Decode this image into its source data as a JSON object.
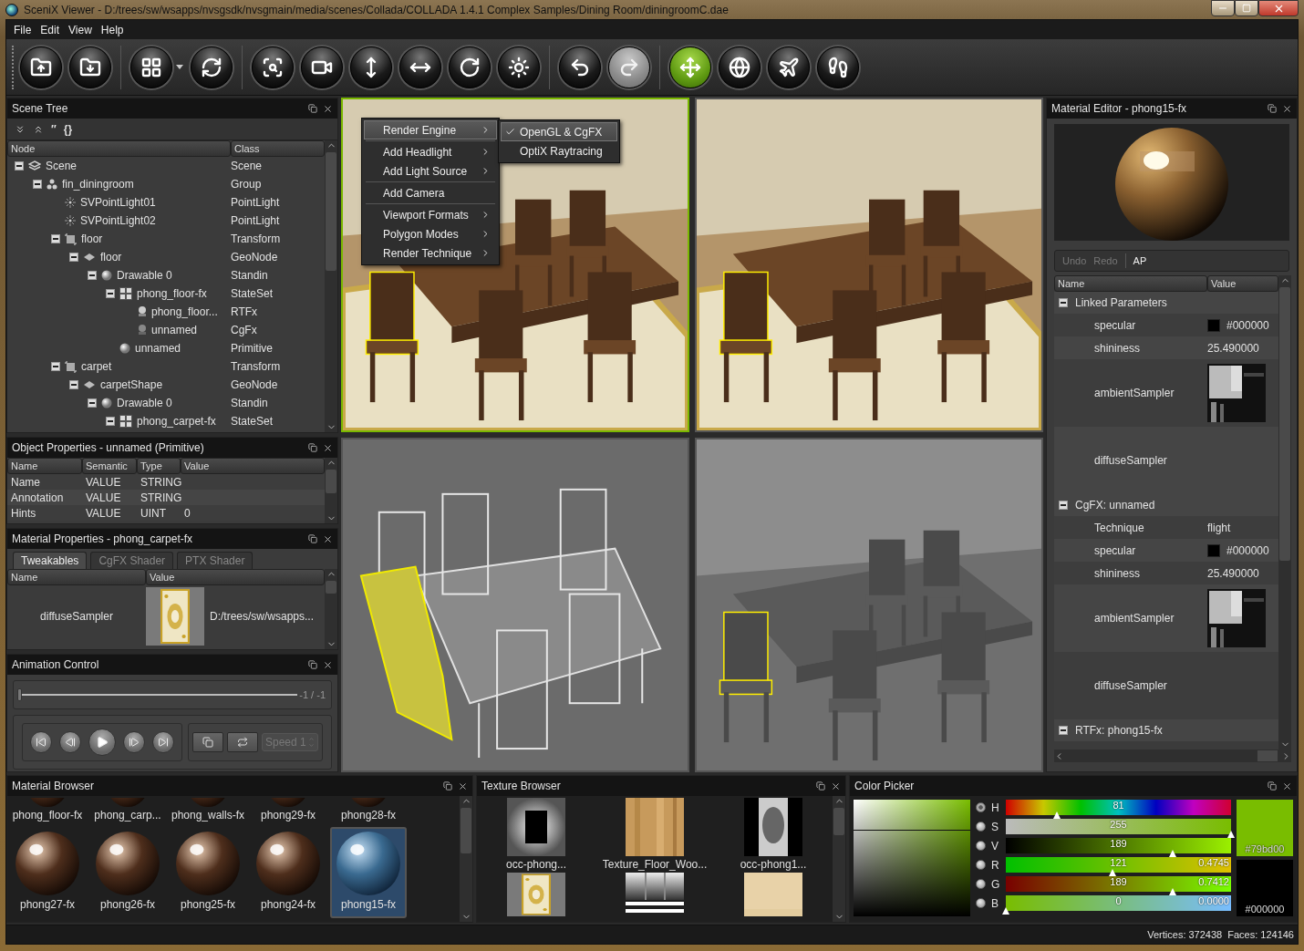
{
  "window": {
    "title": "SceniX Viewer - D:/trees/sw/wsapps/nvsgsdk/nvsgmain/media/scenes/Collada/COLLADA 1.4.1 Complex Samples/Dining Room/diningroomC.dae"
  },
  "menu": [
    "File",
    "Edit",
    "View",
    "Help"
  ],
  "toolbar": [
    [
      {
        "kind": "open",
        "selected": false,
        "disabled": false
      },
      {
        "kind": "save",
        "selected": false,
        "disabled": false
      }
    ],
    [
      {
        "kind": "layout",
        "selected": false,
        "disabled": false
      },
      {
        "kind": "refresh",
        "selected": false,
        "disabled": false
      }
    ],
    [
      {
        "kind": "zoom",
        "selected": false,
        "disabled": false
      },
      {
        "kind": "camera",
        "selected": false,
        "disabled": false
      },
      {
        "kind": "vertical",
        "selected": false,
        "disabled": false
      },
      {
        "kind": "horizontal",
        "selected": false,
        "disabled": false
      },
      {
        "kind": "rotate",
        "selected": false,
        "disabled": false
      },
      {
        "kind": "light",
        "selected": false,
        "disabled": false
      }
    ],
    [
      {
        "kind": "undo",
        "selected": false,
        "disabled": false
      },
      {
        "kind": "redo",
        "selected": false,
        "disabled": true
      }
    ],
    [
      {
        "kind": "navigate",
        "selected": true,
        "disabled": false
      },
      {
        "kind": "orbit",
        "selected": false,
        "disabled": false
      },
      {
        "kind": "fly",
        "selected": false,
        "disabled": false
      },
      {
        "kind": "walk",
        "selected": false,
        "disabled": false
      }
    ]
  ],
  "scene_tree": {
    "title": "Scene Tree",
    "tools": [
      {
        "kind": "expand"
      },
      {
        "kind": "collapse"
      },
      {
        "kind": "text",
        "label": "″"
      },
      {
        "kind": "text",
        "label": "{}"
      }
    ],
    "columns": [
      "Node",
      "Class"
    ],
    "nodes": [
      {
        "name": "Scene",
        "class": "Scene",
        "kind": "scene",
        "expanded": true,
        "children": [
          {
            "name": "fin_diningroom",
            "class": "Group",
            "kind": "group",
            "expanded": true,
            "children": [
              {
                "name": "SVPointLight01",
                "class": "PointLight",
                "kind": "light",
                "expanded": false
              },
              {
                "name": "SVPointLight02",
                "class": "PointLight",
                "kind": "light",
                "expanded": false
              },
              {
                "name": "floor",
                "class": "Transform",
                "kind": "transform",
                "expanded": true,
                "children": [
                  {
                    "name": "floor",
                    "class": "GeoNode",
                    "kind": "geonode",
                    "expanded": true,
                    "children": [
                      {
                        "name": "Drawable 0",
                        "class": "Standin",
                        "kind": "drawable",
                        "expanded": true,
                        "children": [
                          {
                            "name": "phong_floor-fx",
                            "class": "StateSet",
                            "kind": "stateset",
                            "expanded": true,
                            "children": [
                              {
                                "name": "phong_floor...",
                                "class": "RTFx",
                                "kind": "rtfx",
                                "expanded": false
                              },
                              {
                                "name": "unnamed",
                                "class": "CgFx",
                                "kind": "cgfx",
                                "expanded": false
                              }
                            ]
                          },
                          {
                            "name": "unnamed",
                            "class": "Primitive",
                            "kind": "drawable",
                            "expanded": false
                          }
                        ]
                      }
                    ]
                  }
                ]
              },
              {
                "name": "carpet",
                "class": "Transform",
                "kind": "transform",
                "expanded": true,
                "children": [
                  {
                    "name": "carpetShape",
                    "class": "GeoNode",
                    "kind": "geonode",
                    "expanded": true,
                    "children": [
                      {
                        "name": "Drawable 0",
                        "class": "Standin",
                        "kind": "drawable",
                        "expanded": true,
                        "children": [
                          {
                            "name": "phong_carpet-fx",
                            "class": "StateSet",
                            "kind": "stateset",
                            "expanded": true
                          }
                        ]
                      }
                    ]
                  }
                ]
              }
            ]
          }
        ]
      }
    ]
  },
  "object_properties": {
    "title": "Object Properties - unnamed (Primitive)",
    "columns": [
      "Name",
      "Semantic",
      "Type",
      "Value"
    ],
    "rows": [
      {
        "cells": [
          "Name",
          "VALUE",
          "STRING"
        ]
      },
      {
        "cells": [
          "Annotation",
          "VALUE",
          "STRING"
        ]
      },
      {
        "cells": [
          "Hints",
          "VALUE",
          "UINT",
          "0"
        ]
      }
    ]
  },
  "material_properties": {
    "title": "Material Properties - phong_carpet-fx",
    "tabs": [
      {
        "label": "Tweakables",
        "selected": true
      },
      {
        "label": "CgFX Shader",
        "selected": false
      },
      {
        "label": "PTX Shader",
        "selected": false
      }
    ],
    "columns": [
      "Name",
      "Value"
    ],
    "rows": [
      {
        "name": "diffuseSampler",
        "value": "D:/trees/sw/wsapps..."
      }
    ]
  },
  "animation": {
    "title": "Animation Control",
    "slider": {
      "level": 0,
      "reading": "-1 / -1"
    },
    "controls": [
      {
        "kind": "first"
      },
      {
        "kind": "prev"
      },
      {
        "kind": "play"
      },
      {
        "kind": "next"
      },
      {
        "kind": "last"
      }
    ],
    "tools": [
      {
        "kind": "snapshot"
      },
      {
        "kind": "loop"
      }
    ],
    "speed": {
      "value": "Speed 1",
      "disabled": true
    }
  },
  "viewports": [
    {
      "kind": "shaded",
      "selected": true
    },
    {
      "kind": "shaded",
      "selected": false
    },
    {
      "kind": "wireframe",
      "selected": false
    },
    {
      "kind": "grey",
      "selected": false
    }
  ],
  "context_menu": {
    "groups": [
      [
        {
          "label": "Render Engine",
          "submenu": true,
          "selected": true
        }
      ],
      [
        {
          "label": "Add Headlight",
          "submenu": true,
          "selected": false
        },
        {
          "label": "Add Light Source",
          "submenu": true,
          "selected": false
        }
      ],
      [
        {
          "label": "Add Camera",
          "submenu": false,
          "selected": false
        }
      ],
      [
        {
          "label": "Viewport Formats",
          "submenu": true,
          "selected": false
        },
        {
          "label": "Polygon Modes",
          "submenu": true,
          "selected": false
        },
        {
          "label": "Render Technique",
          "submenu": true,
          "selected": false
        }
      ]
    ],
    "submenu": [
      {
        "label": "OpenGL & CgFX",
        "checked": true,
        "selected": true
      },
      {
        "label": "OptiX Raytracing",
        "checked": false,
        "selected": false
      }
    ]
  },
  "material_editor": {
    "title": "Material Editor - phong15-fx",
    "tools": [
      {
        "label": "Undo",
        "disabled": true
      },
      {
        "label": "Redo",
        "disabled": true
      },
      {
        "label": "AP",
        "disabled": false
      }
    ],
    "columns": [
      "Name",
      "Value"
    ],
    "groups": [
      {
        "label": "Linked Parameters",
        "expanded": true,
        "rows": [
          {
            "kind": "color",
            "name": "specular",
            "value": "#000000",
            "color": "#000000"
          },
          {
            "kind": "text",
            "name": "shininess",
            "value": "25.490000"
          },
          {
            "kind": "texture",
            "name": "ambientSampler"
          },
          {
            "kind": "none",
            "name": "diffuseSampler"
          }
        ]
      },
      {
        "label": "CgFX: unnamed",
        "expanded": true,
        "rows": [
          {
            "kind": "text",
            "name": "Technique",
            "value": "flight"
          },
          {
            "kind": "color",
            "name": "specular",
            "value": "#000000",
            "color": "#000000"
          },
          {
            "kind": "text",
            "name": "shininess",
            "value": "25.490000"
          },
          {
            "kind": "texture",
            "name": "ambientSampler"
          },
          {
            "kind": "none",
            "name": "diffuseSampler"
          }
        ]
      },
      {
        "label": "RTFx: phong15-fx",
        "expanded": true
      }
    ]
  },
  "material_browser": {
    "title": "Material Browser",
    "items": [
      {
        "label": "phong_floor-fx",
        "selected": false,
        "cropped": true
      },
      {
        "label": "phong_carp...",
        "selected": false,
        "cropped": true
      },
      {
        "label": "phong_walls-fx",
        "selected": false,
        "cropped": true
      },
      {
        "label": "phong29-fx",
        "selected": false,
        "cropped": true
      },
      {
        "label": "phong28-fx",
        "selected": false,
        "cropped": true
      },
      {
        "label": "phong27-fx",
        "selected": false,
        "cropped": false
      },
      {
        "label": "phong26-fx",
        "selected": false,
        "cropped": false
      },
      {
        "label": "phong25-fx",
        "selected": false,
        "cropped": false
      },
      {
        "label": "phong24-fx",
        "selected": false,
        "cropped": false
      },
      {
        "label": "phong15-fx",
        "selected": true,
        "cropped": false
      }
    ]
  },
  "texture_browser": {
    "title": "Texture Browser",
    "items": [
      {
        "kind": "thumbnail",
        "label": "occ-phong..."
      },
      {
        "kind": "thumbnail",
        "label": "Texture_Floor_Woo..."
      },
      {
        "kind": "thumbnail",
        "label": "occ-phong1..."
      },
      {
        "kind": "picture"
      },
      {
        "kind": "picture"
      },
      {
        "kind": "picture"
      }
    ]
  },
  "color_picker": {
    "title": "Color Picker",
    "channels": [
      {
        "label": "H",
        "kind": "hue",
        "selected": true,
        "level": 0.225,
        "value": "81"
      },
      {
        "label": "S",
        "kind": "saturation",
        "selected": false,
        "level": 1,
        "value": "255"
      },
      {
        "label": "V",
        "kind": "brightness",
        "selected": false,
        "level": 0.74,
        "value": "189"
      },
      {
        "label": "R",
        "kind": "red",
        "selected": false,
        "level": 0.4745,
        "value": "121",
        "fraction": "0.4745"
      },
      {
        "label": "G",
        "kind": "green",
        "selected": false,
        "level": 0.7412,
        "value": "189",
        "fraction": "0.7412"
      },
      {
        "label": "B",
        "kind": "blue",
        "selected": false,
        "level": 0,
        "value": "0",
        "fraction": "0.0000"
      }
    ],
    "swatches": [
      {
        "label": "#79bd00",
        "color": "#79bd00"
      },
      {
        "label": "#000000",
        "color": "#000000"
      }
    ]
  },
  "status_bar": [
    "Vertices: 372438",
    "Faces: 124146"
  ]
}
